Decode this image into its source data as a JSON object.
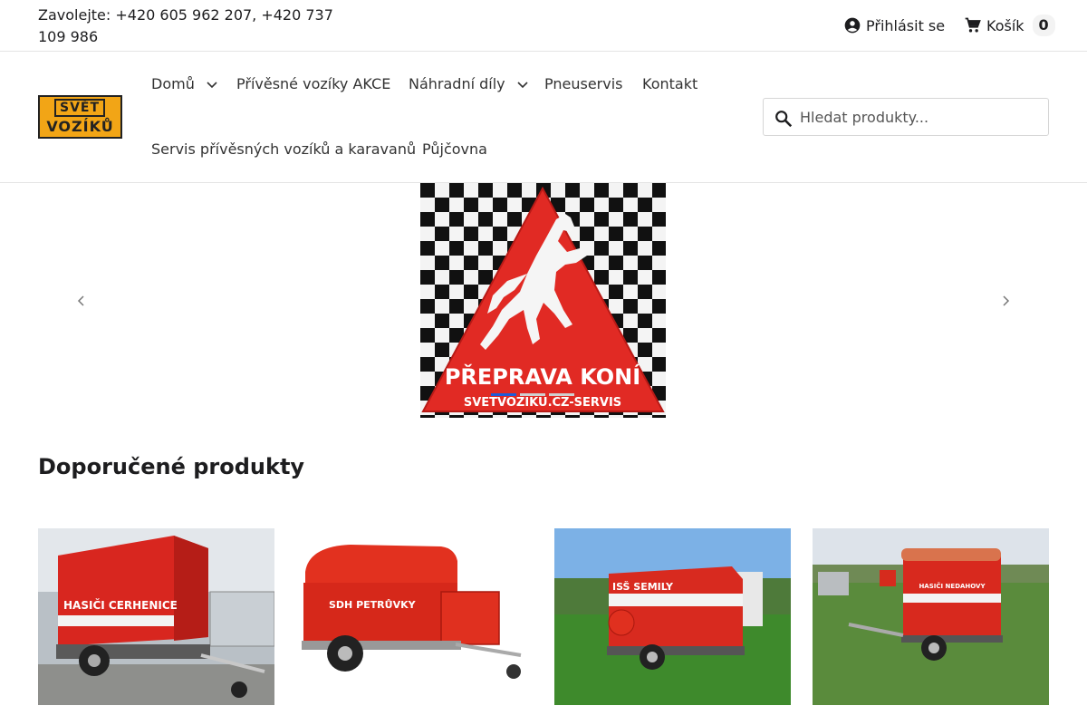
{
  "topbar": {
    "phone_text": "Zavolejte: +420 605 962 207, +420 737 109 986",
    "login_label": "Přihlásit se",
    "cart_label": "Košík",
    "cart_count": "0"
  },
  "logo": {
    "line1": "SVĚT",
    "line2": "VOZÍKŮ"
  },
  "nav": {
    "home": "Domů",
    "trailers_sale": "Přívěsné vozíky AKCE",
    "spare_parts": "Náhradní díly",
    "tire_service": "Pneuservis",
    "contact": "Kontakt",
    "service": "Servis přívěsných vozíků a karavanů",
    "rental": "Půjčovna"
  },
  "search": {
    "placeholder": "Hledat produkty..."
  },
  "slider": {
    "slide_text": "PŘEPRAVA KONÍ",
    "slide_subtext": "SVETVOZIKU.CZ-SERVIS",
    "active_index": 0,
    "slide_count": 3
  },
  "section": {
    "title": "Doporučené produkty"
  },
  "products": [
    {
      "label": "HASIČI CERHENICE"
    },
    {
      "label": "SDH PETRŮVKY"
    },
    {
      "label": "ISŠ SEMILY"
    },
    {
      "label": "HASIČI NEDAHOVY"
    }
  ],
  "colors": {
    "accent": "#1e5bd8",
    "logo": "#f2a516",
    "trailer_red": "#e0261d"
  },
  "icons": [
    "account-circle-icon",
    "cart-icon",
    "chevron-down-icon",
    "search-icon",
    "chevron-left-icon",
    "chevron-right-icon"
  ]
}
